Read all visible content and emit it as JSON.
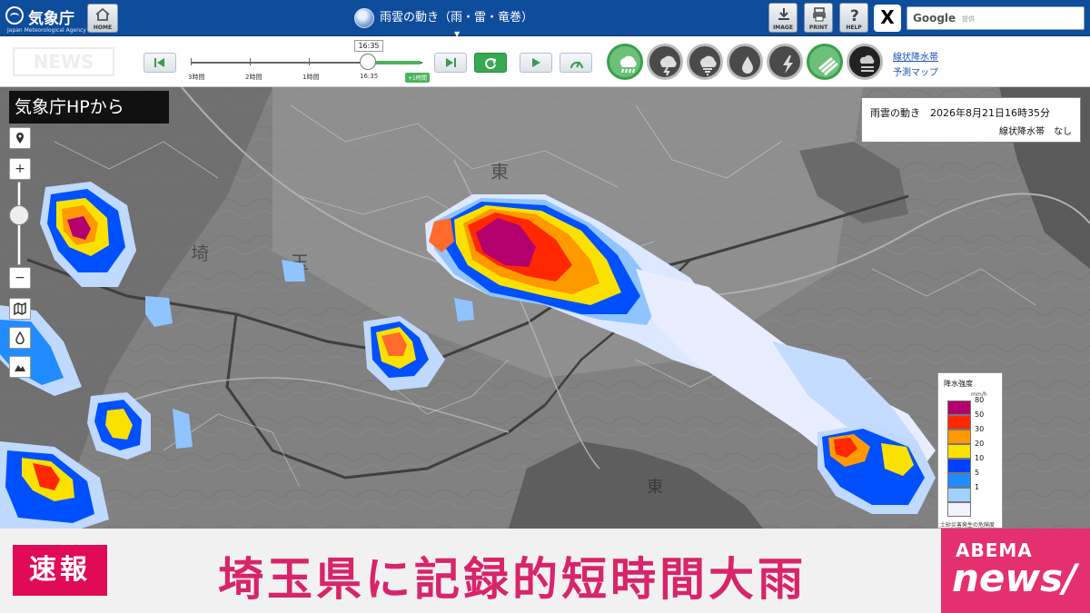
{
  "header": {
    "logo_text": "気象庁",
    "logo_en": "Japan Meteorological Agency",
    "home_label": "HOME",
    "title": "雨雲の動き（雨・雷・竜巻）",
    "image_label": "IMAGE",
    "print_label": "PRINT",
    "help_label": "HELP",
    "x_label": "X",
    "search_brand": "Google",
    "search_placeholder": "提供"
  },
  "controls": {
    "current_time": "16:35",
    "timeline_labels": [
      "3時間",
      "2時間",
      "1時間",
      "16:35"
    ],
    "plus_label": "+1時間",
    "link_line1": "線状降水帯",
    "link_line2": "予測マップ",
    "layer_icons": [
      "rain-cloud-icon",
      "thunder-cloud-icon",
      "tornado-cloud-icon",
      "raindrop-icon",
      "lightning-icon",
      "linear-rainband-icon",
      "multi-layer-icon"
    ]
  },
  "overlay": {
    "source_tag": "気象庁HPから",
    "watermark": "NEWS"
  },
  "info_box": {
    "line1": "雨雲の動き　2026年8月21日16時35分",
    "line2": "線状降水帯　なし"
  },
  "map_labels": {
    "kanji_1": "埼",
    "kanji_2": "玉",
    "kanji_3": "東",
    "kanji_4": "東"
  },
  "legend": {
    "title": "降水強度",
    "unit": "mm/h",
    "levels": [
      {
        "value": "80",
        "color": "#b4006e"
      },
      {
        "value": "50",
        "color": "#ff2800"
      },
      {
        "value": "30",
        "color": "#ff9900"
      },
      {
        "value": "20",
        "color": "#fae100"
      },
      {
        "value": "10",
        "color": "#0041ff"
      },
      {
        "value": "5",
        "color": "#218cff"
      },
      {
        "value": "1",
        "color": "#a0d2ff"
      },
      {
        "value": "",
        "color": "#f2f2ff"
      }
    ],
    "footnote": "土砂災害発生の危険度"
  },
  "caption": {
    "badge": "速報",
    "headline": "埼玉県に記録的短時間大雨",
    "brand_top": "ABEMA",
    "brand_bottom": "news/"
  },
  "colors": {
    "header_bg": "#0e4c9c",
    "accent_pink": "#e10a57",
    "headline_pink": "#d8246a",
    "active_green": "#39a852"
  }
}
